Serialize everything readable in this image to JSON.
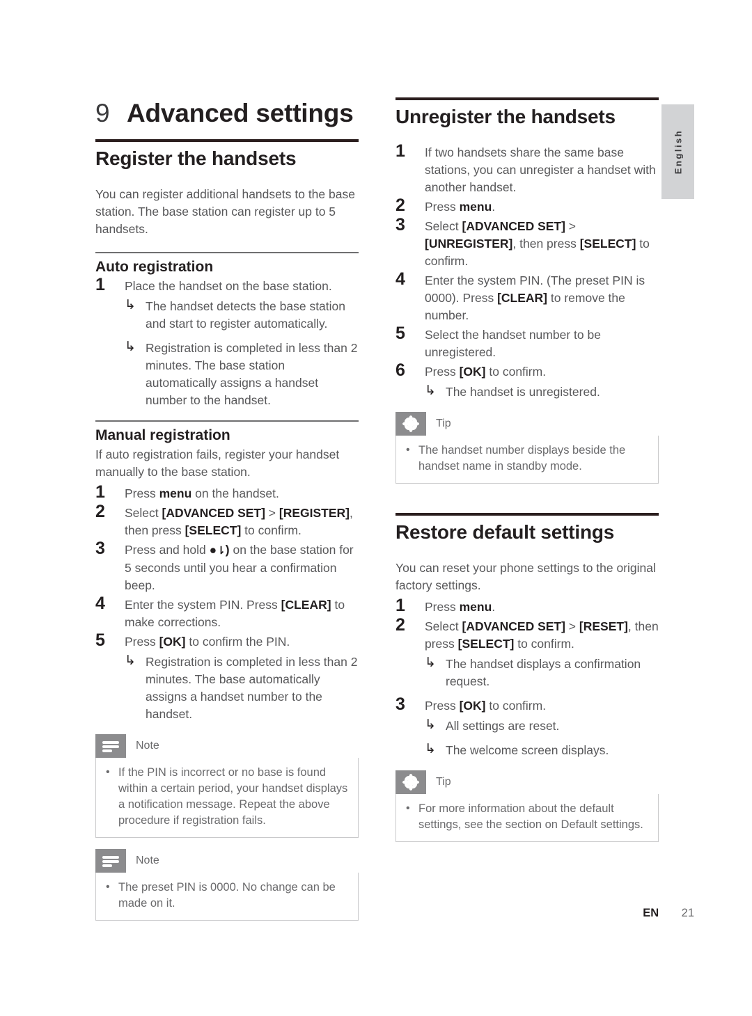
{
  "document": {
    "language_tab": "English",
    "footer": {
      "language_code": "EN",
      "page_number": "21"
    }
  },
  "chapter": {
    "number": "9",
    "title": "Advanced settings"
  },
  "left_column": {
    "register_section": {
      "heading": "Register the handsets",
      "intro": "You can register additional handsets to the base station. The base station can register up to 5 handsets.",
      "auto": {
        "heading": "Auto registration",
        "steps": [
          {
            "num": "1",
            "text": "Place the handset on the base station.",
            "results": [
              "The handset detects the base station and start to register automatically.",
              "Registration is completed in less than 2 minutes. The base station automatically assigns a handset number to the handset."
            ]
          }
        ]
      },
      "manual": {
        "heading": "Manual registration",
        "intro": "If auto registration fails, register your handset manually to the base station.",
        "steps": [
          {
            "num": "1",
            "text_pre": "Press ",
            "text_bold": "menu",
            "text_post": " on the handset.",
            "results": []
          },
          {
            "num": "2",
            "text_pre": "Select ",
            "text_bold": "[ADVANCED SET]",
            "text_mid": " > ",
            "text_bold2": "[REGISTER]",
            "text_mid2": ", then press ",
            "text_bold3": "[SELECT]",
            "text_post": " to confirm.",
            "results": []
          },
          {
            "num": "3",
            "text_pre": "Press and hold ",
            "icon": "paging-icon",
            "text_post": " on the base station for 5 seconds until you hear a confirmation beep.",
            "results": []
          },
          {
            "num": "4",
            "text_pre": "Enter the system PIN. Press ",
            "text_bold": "[CLEAR]",
            "text_post": " to make corrections.",
            "results": []
          },
          {
            "num": "5",
            "text_pre": "Press ",
            "text_bold": "[OK]",
            "text_post": " to confirm the PIN.",
            "results": [
              "Registration is completed in less than 2 minutes. The base automatically assigns a handset number to the handset."
            ]
          }
        ]
      },
      "note_1": {
        "label": "Note",
        "items": [
          "If the PIN is incorrect or no base is found within a certain period, your handset displays a notification message. Repeat the above procedure if registration fails."
        ]
      },
      "note_2": {
        "label": "Note",
        "items": [
          "The preset PIN is 0000. No change can be made on it."
        ]
      }
    }
  },
  "right_column": {
    "unregister_section": {
      "heading": "Unregister the handsets",
      "steps": [
        {
          "num": "1",
          "text_pre": "If two handsets share the same base stations, you can unregister a handset with another handset.",
          "results": []
        },
        {
          "num": "2",
          "text_pre": "Press ",
          "text_bold": "menu",
          "text_post": ".",
          "results": []
        },
        {
          "num": "3",
          "text_pre": "Select ",
          "text_bold": "[ADVANCED SET]",
          "text_mid": " > ",
          "text_bold2": "[UNREGISTER]",
          "text_mid2": ", then press ",
          "text_bold3": "[SELECT]",
          "text_post": " to confirm.",
          "results": []
        },
        {
          "num": "4",
          "text_pre": "Enter the system PIN. (The preset PIN is 0000). Press ",
          "text_bold": "[CLEAR]",
          "text_post": " to remove the number.",
          "results": []
        },
        {
          "num": "5",
          "text_pre": "Select the handset number to be unregistered.",
          "results": []
        },
        {
          "num": "6",
          "text_pre": "Press ",
          "text_bold": "[OK]",
          "text_post": " to confirm.",
          "results": [
            "The handset is unregistered."
          ]
        }
      ],
      "tip": {
        "label": "Tip",
        "items": [
          "The handset number displays beside the handset name in standby mode."
        ]
      }
    },
    "restore_section": {
      "heading": "Restore default settings",
      "intro": "You can reset your phone settings to the original factory settings.",
      "steps": [
        {
          "num": "1",
          "text_pre": "Press ",
          "text_bold": "menu",
          "text_post": ".",
          "results": []
        },
        {
          "num": "2",
          "text_pre": "Select ",
          "text_bold": "[ADVANCED SET]",
          "text_mid": " > ",
          "text_bold2": "[RESET]",
          "text_mid2": ", then press ",
          "text_bold3": "[SELECT]",
          "text_post": " to confirm.",
          "results": [
            "The handset displays a confirmation request."
          ]
        },
        {
          "num": "3",
          "text_pre": "Press ",
          "text_bold": "[OK]",
          "text_post": " to confirm.",
          "results": [
            "All settings are reset.",
            "The welcome screen displays."
          ]
        }
      ],
      "tip": {
        "label": "Tip",
        "items": [
          "For more information about the default settings, see the section on Default settings."
        ]
      }
    }
  },
  "colors": {
    "rule_dark": "#2b1e1e",
    "heading_black": "#231f20",
    "body_gray": "#58585a",
    "callout_badge": "#8c8c8e",
    "lang_tab_bg": "#d2d3d5"
  }
}
